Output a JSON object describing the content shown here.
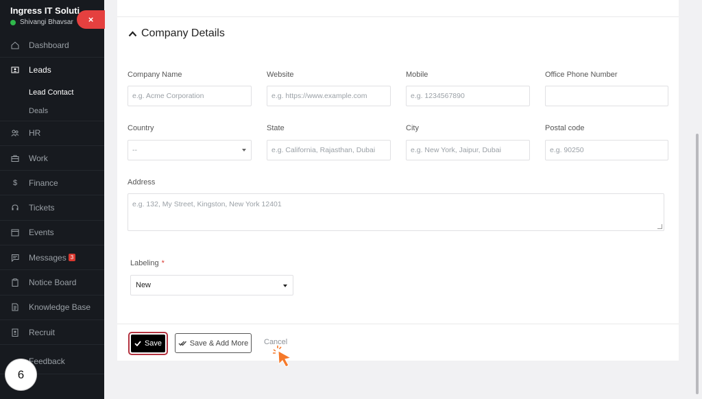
{
  "sidebar": {
    "app_name": "Ingress IT Soluti...",
    "user_name": "Shivangi Bhavsar",
    "close_label": "×",
    "items": [
      {
        "label": "Dashboard",
        "icon": "home-icon"
      },
      {
        "label": "Leads",
        "icon": "contact-card-icon"
      },
      {
        "label": "HR",
        "icon": "users-icon"
      },
      {
        "label": "Work",
        "icon": "briefcase-icon"
      },
      {
        "label": "Finance",
        "icon": "dollar-icon"
      },
      {
        "label": "Tickets",
        "icon": "headset-icon"
      },
      {
        "label": "Events",
        "icon": "calendar-icon"
      },
      {
        "label": "Messages",
        "icon": "chat-icon",
        "badge": "3"
      },
      {
        "label": "Notice Board",
        "icon": "clipboard-icon"
      },
      {
        "label": "Knowledge Base",
        "icon": "document-icon"
      },
      {
        "label": "Recruit",
        "icon": "badge-icon"
      },
      {
        "label": "Feedback",
        "icon": "feedback-icon"
      }
    ],
    "leads_sub": [
      "Lead Contact",
      "Deals"
    ]
  },
  "step_number": "6",
  "section": {
    "title": "Company Details"
  },
  "form": {
    "company_name": {
      "label": "Company Name",
      "placeholder": "e.g. Acme Corporation"
    },
    "website": {
      "label": "Website",
      "placeholder": "e.g. https://www.example.com"
    },
    "mobile": {
      "label": "Mobile",
      "placeholder": "e.g. 1234567890"
    },
    "office_phone": {
      "label": "Office Phone Number",
      "placeholder": ""
    },
    "country": {
      "label": "Country",
      "value": "--"
    },
    "state": {
      "label": "State",
      "placeholder": "e.g. California, Rajasthan, Dubai"
    },
    "city": {
      "label": "City",
      "placeholder": "e.g. New York, Jaipur, Dubai"
    },
    "postal_code": {
      "label": "Postal code",
      "placeholder": "e.g. 90250"
    },
    "address": {
      "label": "Address",
      "placeholder": "e.g. 132, My Street, Kingston, New York 12401"
    },
    "labeling": {
      "label": "Labeling",
      "required_mark": "*",
      "value": "New"
    }
  },
  "actions": {
    "save": "Save",
    "save_add_more": "Save & Add More",
    "cancel": "Cancel"
  },
  "colors": {
    "sidebar_bg": "#171a1f",
    "close_tab": "#e5403f",
    "save_border": "#b3323f",
    "cursor": "#f5792a"
  }
}
